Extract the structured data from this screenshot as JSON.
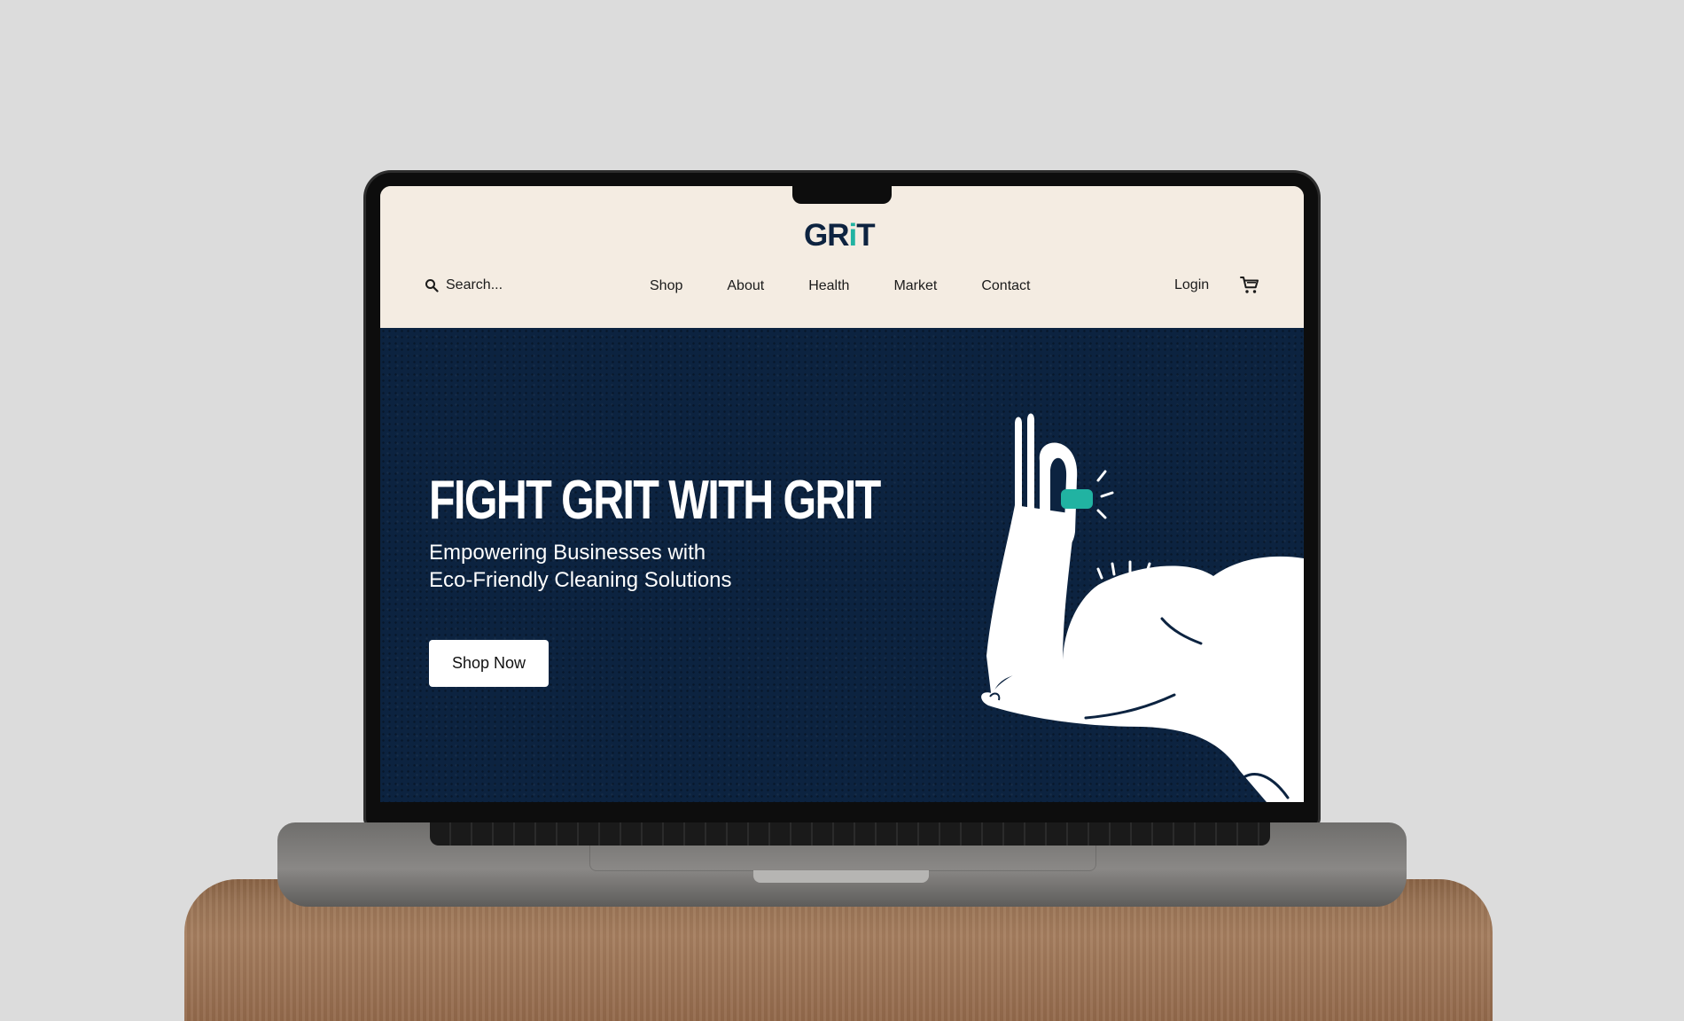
{
  "header": {
    "brand_main": "GR",
    "brand_i": "i",
    "brand_t": "T",
    "search_placeholder": "Search...",
    "nav": [
      "Shop",
      "About",
      "Health",
      "Market",
      "Contact"
    ],
    "login_label": "Login"
  },
  "hero": {
    "title": "FIGHT GRIT WITH GRIT",
    "subtitle_line1": "Empowering Businesses with",
    "subtitle_line2": "Eco-Friendly Cleaning Solutions",
    "cta_label": "Shop Now"
  },
  "colors": {
    "navy": "#0c2340",
    "cream": "#f4ece2",
    "teal": "#21b3a2",
    "white": "#ffffff"
  },
  "icons": [
    "search-icon",
    "cart-icon",
    "flexing-arm-illustration"
  ]
}
